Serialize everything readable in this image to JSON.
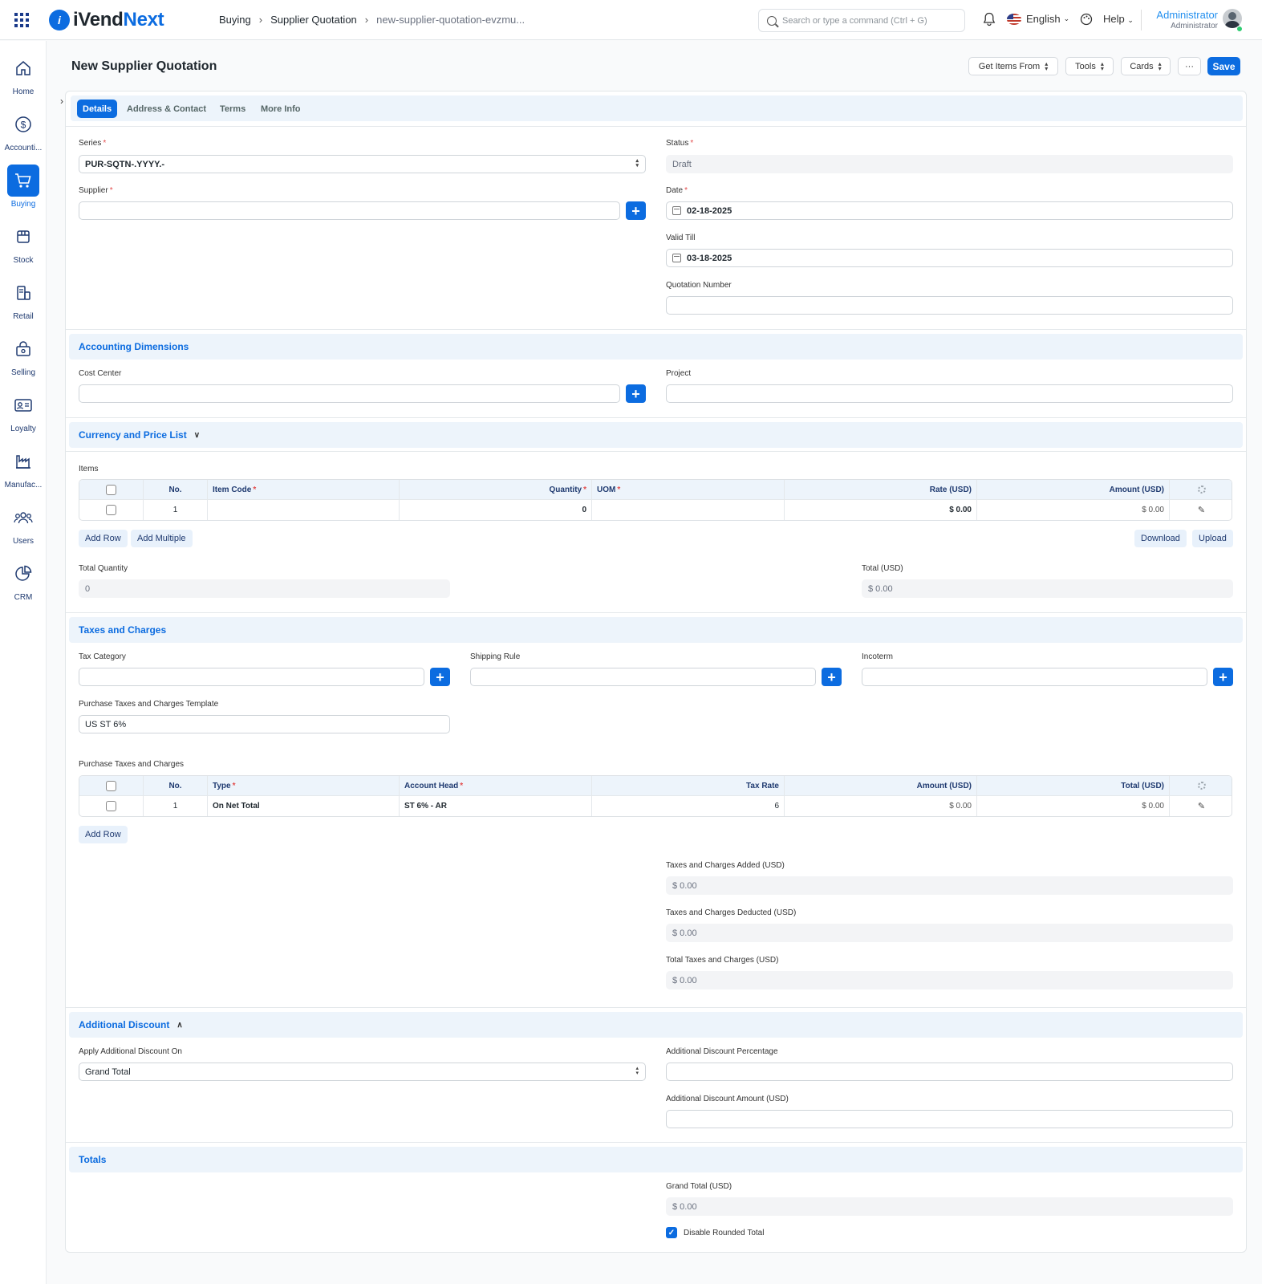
{
  "app": {
    "logo_mark": "i",
    "logo_i": "iVend",
    "logo_next": "Next"
  },
  "breadcrumb": [
    "Buying",
    "Supplier Quotation",
    "new-supplier-quotation-evzmu..."
  ],
  "search": {
    "placeholder": "Search or type a command (Ctrl + G)"
  },
  "nav": {
    "language": "English",
    "help": "Help",
    "user_name": "Administrator",
    "user_role": "Administrator"
  },
  "sidebar": [
    {
      "label": "Home",
      "icon": "home-icon"
    },
    {
      "label": "Accounti...",
      "icon": "dollar-icon"
    },
    {
      "label": "Buying",
      "icon": "cart-icon",
      "active": true
    },
    {
      "label": "Stock",
      "icon": "box-icon"
    },
    {
      "label": "Retail",
      "icon": "retail-icon"
    },
    {
      "label": "Selling",
      "icon": "shopping-bag-icon"
    },
    {
      "label": "Loyalty",
      "icon": "id-card-icon"
    },
    {
      "label": "Manufac...",
      "icon": "factory-icon"
    },
    {
      "label": "Users",
      "icon": "users-icon"
    },
    {
      "label": "CRM",
      "icon": "pie-chart-icon"
    }
  ],
  "page": {
    "title": "New Supplier Quotation",
    "buttons": {
      "get_items": "Get Items From",
      "tools": "Tools",
      "cards": "Cards",
      "more": "···",
      "save": "Save"
    }
  },
  "tabs": [
    "Details",
    "Address & Contact",
    "Terms",
    "More Info"
  ],
  "details": {
    "series_label": "Series",
    "series_value": "PUR-SQTN-.YYYY.-",
    "supplier_label": "Supplier",
    "supplier_value": "",
    "status_label": "Status",
    "status_value": "Draft",
    "date_label": "Date",
    "date_value": "02-18-2025",
    "valid_till_label": "Valid Till",
    "valid_till_value": "03-18-2025",
    "quotation_number_label": "Quotation Number",
    "quotation_number_value": ""
  },
  "accounting": {
    "title": "Accounting Dimensions",
    "cost_center_label": "Cost Center",
    "project_label": "Project"
  },
  "currency": {
    "title": "Currency and Price List"
  },
  "items": {
    "label": "Items",
    "columns": [
      "No.",
      "Item Code",
      "Quantity",
      "UOM",
      "Rate (USD)",
      "Amount (USD)"
    ],
    "rows": [
      {
        "no": "1",
        "item_code": "",
        "quantity": "0",
        "uom": "",
        "rate": "$ 0.00",
        "amount": "$ 0.00"
      }
    ],
    "add_row": "Add Row",
    "add_multiple": "Add Multiple",
    "download": "Download",
    "upload": "Upload",
    "total_qty_label": "Total Quantity",
    "total_qty_value": "0",
    "total_label": "Total (USD)",
    "total_value": "$ 0.00"
  },
  "taxes": {
    "title": "Taxes and Charges",
    "tax_category_label": "Tax Category",
    "shipping_rule_label": "Shipping Rule",
    "incoterm_label": "Incoterm",
    "template_label": "Purchase Taxes and Charges Template",
    "template_value": "US ST 6%",
    "table_label": "Purchase Taxes and Charges",
    "columns": [
      "No.",
      "Type",
      "Account Head",
      "Tax Rate",
      "Amount (USD)",
      "Total (USD)"
    ],
    "rows": [
      {
        "no": "1",
        "type": "On Net Total",
        "account_head": "ST 6% - AR",
        "tax_rate": "6",
        "amount": "$ 0.00",
        "total": "$ 0.00"
      }
    ],
    "add_row": "Add Row",
    "added_label": "Taxes and Charges Added (USD)",
    "added_value": "$ 0.00",
    "deducted_label": "Taxes and Charges Deducted (USD)",
    "deducted_value": "$ 0.00",
    "total_label": "Total Taxes and Charges (USD)",
    "total_value": "$ 0.00"
  },
  "discount": {
    "title": "Additional Discount",
    "apply_on_label": "Apply Additional Discount On",
    "apply_on_value": "Grand Total",
    "percentage_label": "Additional Discount Percentage",
    "amount_label": "Additional Discount Amount (USD)"
  },
  "totals": {
    "title": "Totals",
    "grand_total_label": "Grand Total (USD)",
    "grand_total_value": "$ 0.00",
    "disable_rounded_label": "Disable Rounded Total"
  },
  "colors": {
    "primary": "#0c6ce0",
    "section_bg": "#edf4fb",
    "required": "#e24c4c"
  }
}
